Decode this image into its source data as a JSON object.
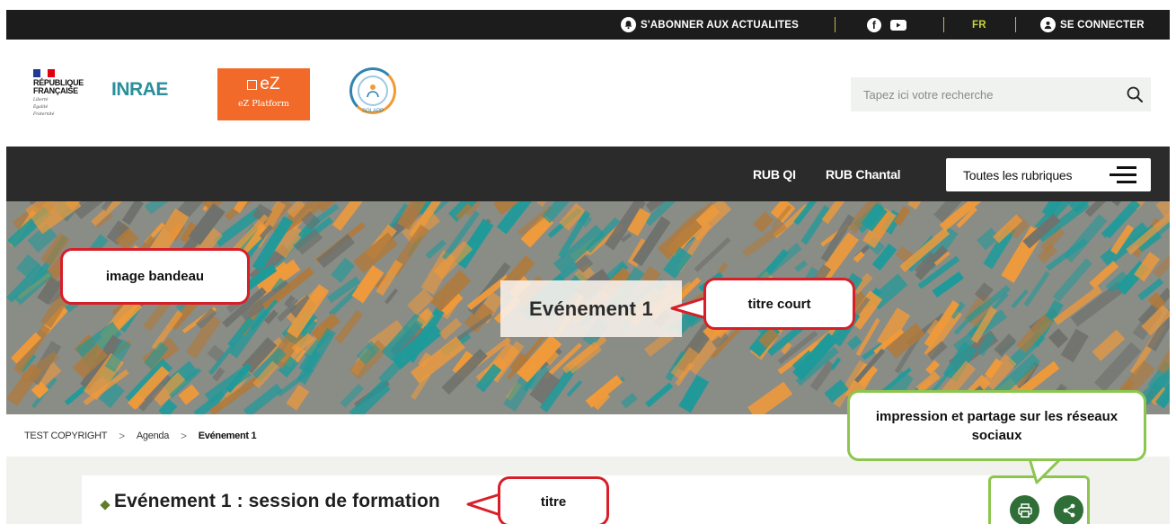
{
  "topbar": {
    "subscribe_label": "S'ABONNER AUX ACTUALITES",
    "language": "FR",
    "login_label": "SE CONNECTER"
  },
  "header": {
    "gov_logo_lines": [
      "RÉPUBLIQUE",
      "FRANÇAISE"
    ],
    "gov_logo_motto": [
      "Liberté",
      "Égalité",
      "Fraternité"
    ],
    "inrae_logo": "INRAE",
    "ez_logo": {
      "title": "eZ",
      "subtitle": "eZ Platform"
    },
    "solapp_logo": "SOLAPP",
    "search_placeholder": "Tapez ici votre recherche"
  },
  "nav": {
    "items": [
      {
        "label": "RUB QI"
      },
      {
        "label": "RUB Chantal"
      }
    ],
    "all_sections_label": "Toutes les rubriques"
  },
  "banner": {
    "short_title": "Evénement 1",
    "colors": {
      "teal": "#1f9a9a",
      "orange": "#f09a3a",
      "grey": "#8a8c86"
    }
  },
  "callouts": {
    "banner_image": "image bandeau",
    "short_title": "titre court",
    "share": "impression et partage sur les réseaux sociaux",
    "title": "titre"
  },
  "breadcrumb": {
    "items": [
      "TEST COPYRIGHT",
      "Agenda",
      "Evénement 1"
    ]
  },
  "content": {
    "title": "Evénement 1 : session de formation",
    "actions": [
      {
        "icon": "printer-icon"
      },
      {
        "icon": "share-icon"
      }
    ]
  },
  "colors": {
    "top_bar": "#1c1c1c",
    "nav_bar": "#2b2b2b",
    "accent_green": "#2f6e37",
    "callout_red": "#d81e28",
    "callout_green": "#8cc64f"
  }
}
